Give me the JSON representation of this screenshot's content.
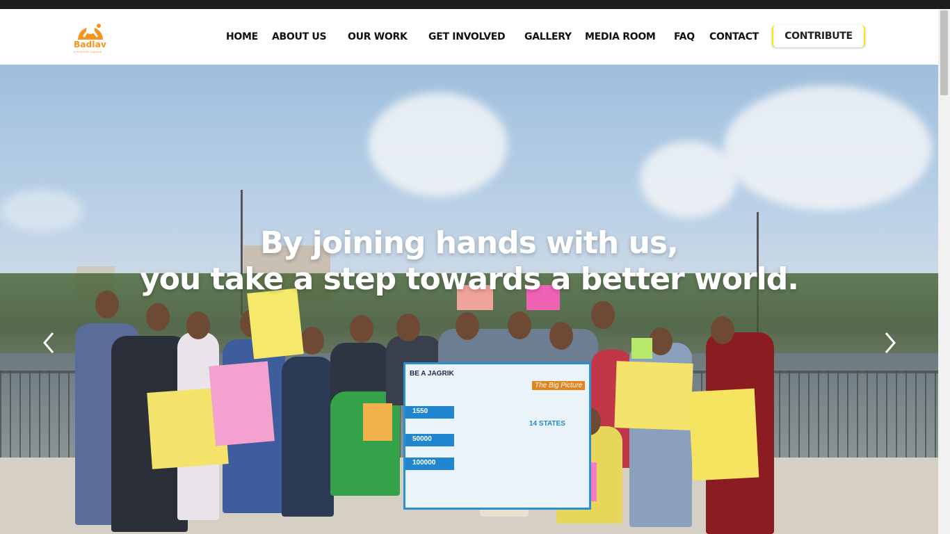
{
  "brand": {
    "name": "Badlav",
    "tagline": "A POSITIVE CHANGE",
    "logo_icon": "badlav-logo-icon",
    "color": "#f7941d"
  },
  "nav": {
    "items": [
      {
        "label": "HOME"
      },
      {
        "label": "ABOUT US"
      },
      {
        "label": "OUR WORK"
      },
      {
        "label": "GET INVOLVED"
      },
      {
        "label": "GALLERY"
      },
      {
        "label": "MEDIA ROOM"
      },
      {
        "label": "FAQ"
      },
      {
        "label": "CONTACT"
      }
    ],
    "cta_label": "CONTRIBUTE",
    "cta_accent": "#ffe500"
  },
  "hero": {
    "title_line1": "By joining hands with us,",
    "title_line2": "you take a step towards a better world.",
    "prev_icon": "chevron-left-icon",
    "next_icon": "chevron-right-icon",
    "banner": {
      "heading": "The Big Picture",
      "logo_text": "BE A JAGRIK",
      "stats": [
        "1550",
        "50000",
        "100000"
      ],
      "states": "14 STATES"
    }
  }
}
